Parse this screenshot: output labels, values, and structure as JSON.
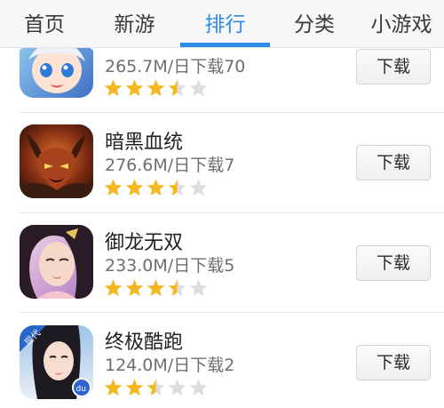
{
  "tabs": [
    {
      "label": "首页",
      "active": false
    },
    {
      "label": "新游",
      "active": false
    },
    {
      "label": "排行",
      "active": true
    },
    {
      "label": "分类",
      "active": false
    },
    {
      "label": "小游戏",
      "active": false
    }
  ],
  "colors": {
    "accent": "#2b8be6",
    "star_filled": "#f3b721",
    "star_empty": "#dedede"
  },
  "apps": [
    {
      "name": "",
      "meta": "265.7M/日下载70",
      "rating": 3.5,
      "button": "下载",
      "icon": "anime-girl-icon"
    },
    {
      "name": "暗黑血统",
      "meta": "276.6M/日下载7",
      "rating": 3.5,
      "button": "下载",
      "icon": "demon-warrior-icon"
    },
    {
      "name": "御龙无双",
      "meta": "233.0M/日下载5",
      "rating": 3.5,
      "button": "下载",
      "icon": "female-portrait-icon"
    },
    {
      "name": "终极酷跑",
      "meta": "124.0M/日下载2",
      "rating": 2.5,
      "button": "下载",
      "icon": "runner-girl-icon"
    }
  ],
  "icon_badges": {
    "runner_corner": "现代",
    "runner_badge": "du"
  }
}
